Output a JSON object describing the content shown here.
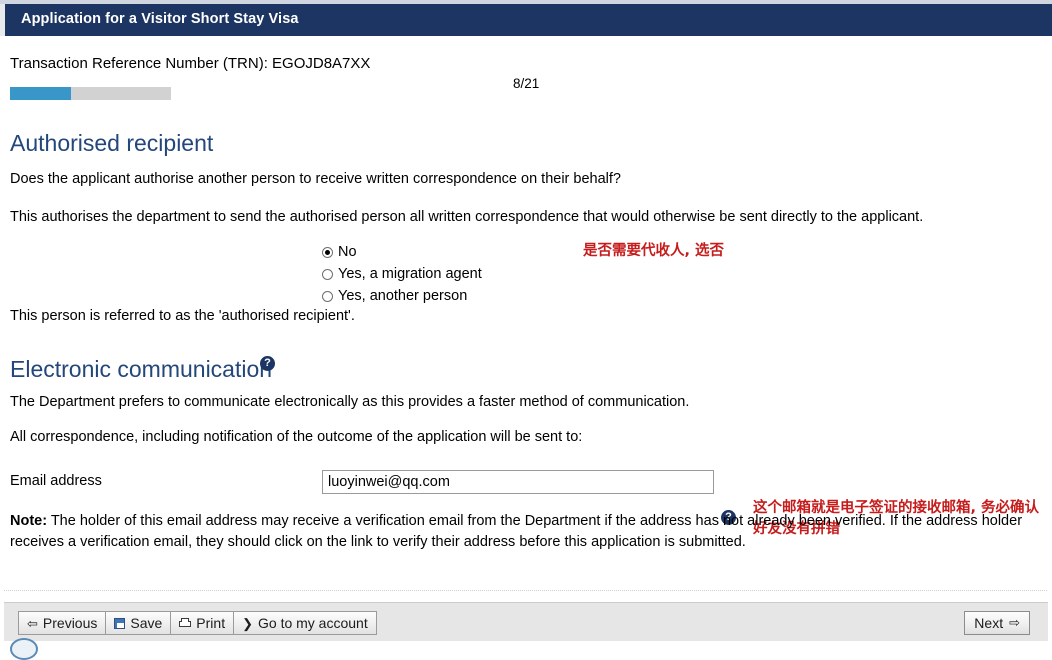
{
  "header": {
    "title": "Application for a Visitor Short Stay Visa",
    "bar_color": "#1d3563"
  },
  "meta": {
    "trn_text": "Transaction Reference Number (TRN): EGOJD8A7XX",
    "page_count": "8/21",
    "progress_percent": 38,
    "progress_fill_color": "#3897c8",
    "progress_track_color": "#d2d2d2"
  },
  "authorised_recipient": {
    "heading": "Authorised recipient",
    "question": "Does the applicant authorise another person to receive written correspondence on their behalf?",
    "explanation": "This authorises the department to send the authorised person all written correspondence that would otherwise be sent directly to the applicant.",
    "options": [
      {
        "label": "No",
        "checked": true
      },
      {
        "label": "Yes, a migration agent",
        "checked": false
      },
      {
        "label": "Yes, another person",
        "checked": false
      }
    ],
    "footnote": "This person is referred to as the 'authorised recipient'."
  },
  "electronic_communication": {
    "heading": "Electronic communication",
    "help_icon": "question-mark-help-icon",
    "prefers_text": "The Department prefers to communicate electronically as this provides a faster method of communication.",
    "correspondence_text": "All correspondence, including notification of the outcome of the application will be sent to:",
    "email_label": "Email address",
    "email_value": "luoyinwei@qq.com",
    "email_placeholder": "",
    "note_bold": "Note:",
    "note_text": " The holder of this email address may receive a verification email from the Department if the address has not already been verified. If the address holder receives a verification email, they should click on the link to verify their address before this application is submitted."
  },
  "annotations": {
    "color": "#c61c1c",
    "radio_note": "是否需要代收人, 选否",
    "email_note": "这个邮箱就是电子签证的接收邮箱, 务必确认好友没有拼错"
  },
  "toolbar": {
    "previous_label": "Previous",
    "previous_icon": "arrow-left-icon",
    "save_label": "Save",
    "save_icon": "floppy-disk-icon",
    "print_label": "Print",
    "print_icon": "printer-icon",
    "account_label": "Go to my account",
    "account_icon": "chevron-right-icon",
    "next_label": "Next",
    "next_icon": "arrow-right-icon"
  },
  "glyphs": {
    "arrow_left": "⇦",
    "arrow_right": "⇨",
    "chevron_right": "❯",
    "question": "?"
  }
}
